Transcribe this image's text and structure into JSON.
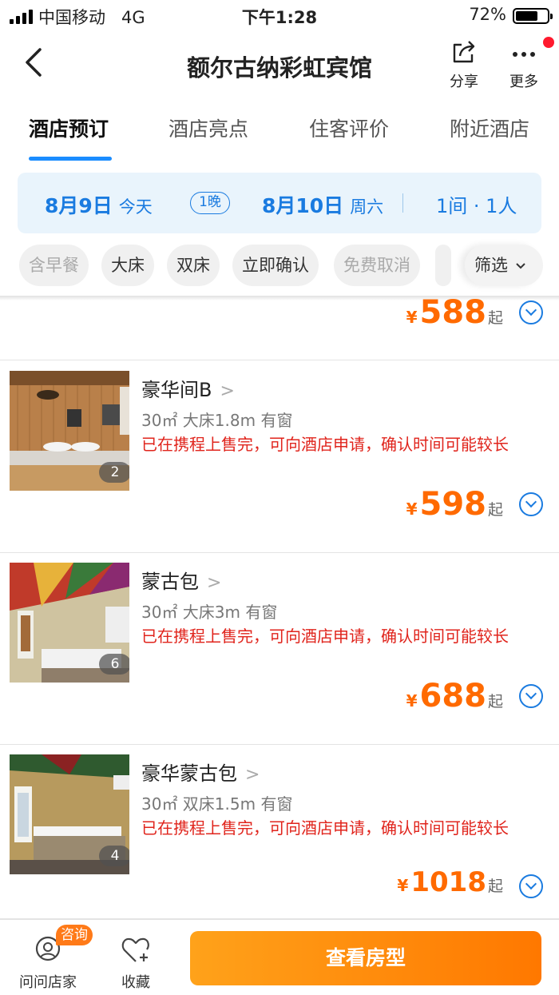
{
  "status_bar": {
    "carrier": "中国移动",
    "network": "4G",
    "time": "下午1:28",
    "battery_pct": "72%",
    "battery_level": 0.72
  },
  "header": {
    "title": "额尔古纳彩虹宾馆",
    "share_label": "分享",
    "more_label": "更多"
  },
  "tabs": [
    {
      "label": "酒店预订",
      "active": true
    },
    {
      "label": "酒店亮点",
      "active": false
    },
    {
      "label": "住客评价",
      "active": false
    },
    {
      "label": "附近酒店",
      "active": false
    }
  ],
  "booking": {
    "checkin_date": "8月9日",
    "checkin_day": "今天",
    "nights": "1晚",
    "checkout_date": "8月10日",
    "checkout_day": "周六",
    "rooms_guests": "1间 · 1人"
  },
  "filters": [
    {
      "label": "含早餐",
      "dim": true
    },
    {
      "label": "大床",
      "dim": false
    },
    {
      "label": "双床",
      "dim": false
    },
    {
      "label": "立即确认",
      "dim": false
    },
    {
      "label": "免费取消",
      "dim": true
    }
  ],
  "filter_button": "筛选",
  "partial_room": {
    "currency": "¥",
    "price": "588",
    "suffix": "起"
  },
  "rooms": [
    {
      "name": "豪华间B",
      "spec": "30㎡ 大床1.8m 有窗",
      "note": "已在携程上售完，可向酒店申请，确认时间可能较长",
      "photo_count": "2",
      "currency": "¥",
      "price": "598",
      "suffix": "起"
    },
    {
      "name": "蒙古包",
      "spec": "30㎡ 大床3m 有窗",
      "note": "已在携程上售完，可向酒店申请，确认时间可能较长",
      "photo_count": "6",
      "currency": "¥",
      "price": "688",
      "suffix": "起"
    },
    {
      "name": "豪华蒙古包",
      "spec": "30㎡ 双床1.5m 有窗",
      "note": "已在携程上售完，可向酒店申请，确认时间可能较长",
      "photo_count": "4",
      "currency": "¥",
      "price": "1018",
      "suffix": "起"
    }
  ],
  "bottom_bar": {
    "consult_badge": "咨询",
    "ask_label": "问问店家",
    "favorite_label": "收藏",
    "cta_label": "查看房型"
  }
}
